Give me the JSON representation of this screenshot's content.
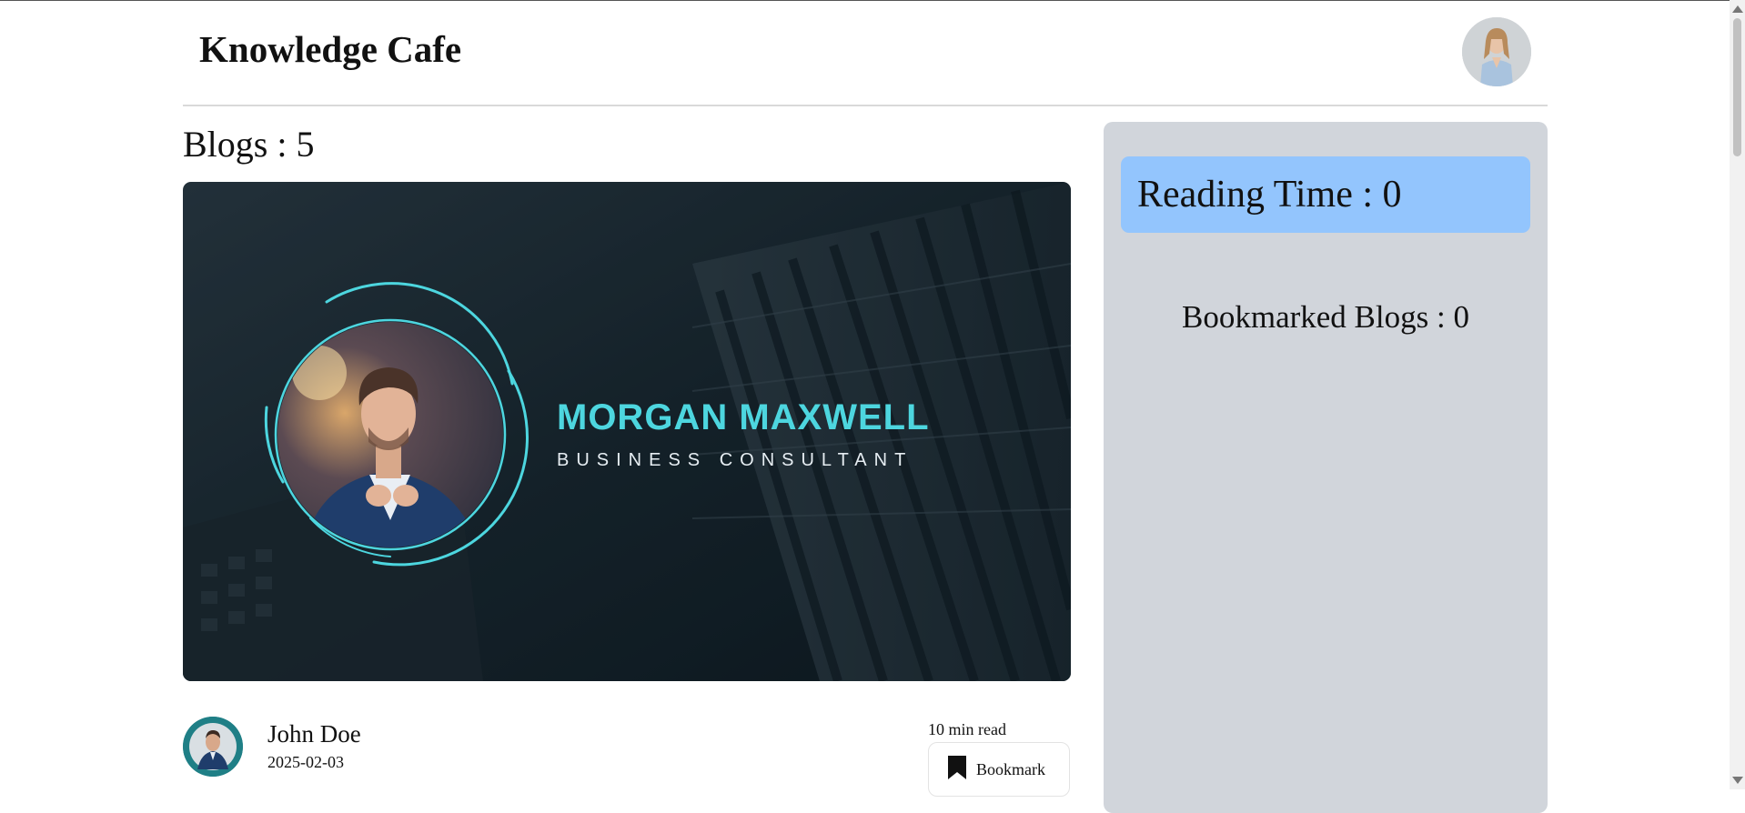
{
  "header": {
    "brand": "Knowledge Cafe"
  },
  "blogs": {
    "title": "Blogs : 5"
  },
  "cover": {
    "name": "MORGAN MAXWELL",
    "role": "BUSINESS CONSULTANT",
    "accent": "#4dd6df",
    "bg": "#14222e"
  },
  "post": {
    "author": "John Doe",
    "date": "2025-02-03",
    "read_time": "10 min read",
    "bookmark_label": "Bookmark"
  },
  "sidebar": {
    "reading_time": "Reading Time : 0",
    "bookmarked": "Bookmarked Blogs : 0",
    "reading_bg": "#93c5fd",
    "panel_bg": "#d1d5db"
  },
  "icons": {
    "bookmark": "bookmark-icon",
    "avatar": "user-avatar"
  }
}
